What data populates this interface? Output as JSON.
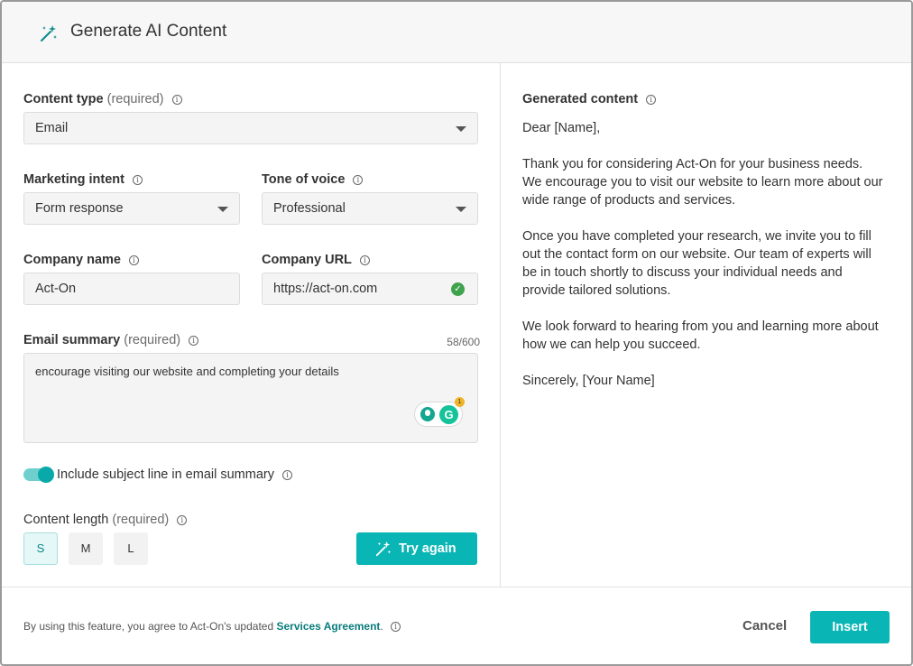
{
  "header": {
    "title": "Generate AI Content",
    "icon": "magic-wand-icon"
  },
  "form": {
    "content_type": {
      "label": "Content type",
      "required": "(required)",
      "value": "Email"
    },
    "marketing_intent": {
      "label": "Marketing intent",
      "value": "Form response"
    },
    "tone_of_voice": {
      "label": "Tone of voice",
      "value": "Professional"
    },
    "company_name": {
      "label": "Company name",
      "value": "Act-On"
    },
    "company_url": {
      "label": "Company URL",
      "value": "https://act-on.com"
    },
    "email_summary": {
      "label": "Email summary",
      "required": "(required)",
      "counter": "58/600",
      "value": "encourage visiting our website and completing your details"
    },
    "grammarly": {
      "letter": "G",
      "badge_count": "1"
    },
    "include_subject": {
      "label": "Include subject line in email summary",
      "enabled": true
    },
    "content_length": {
      "label": "Content length",
      "required": "(required)",
      "options": [
        "S",
        "M",
        "L"
      ],
      "selected": "S"
    },
    "try_again_label": "Try again"
  },
  "generated": {
    "label": "Generated content",
    "paragraphs": [
      "Dear [Name],",
      "Thank you for considering Act-On for your business needs. We encourage you to visit our website to learn more about our wide range of products and services.",
      "Once you have completed your research, we invite you to fill out the contact form on our website. Our team of experts will be in touch shortly to discuss your individual needs and provide tailored solutions.",
      "We look forward to hearing from you and learning more about how we can help you succeed.",
      "Sincerely, [Your Name]"
    ]
  },
  "footer": {
    "legal_prefix": "By using this feature, you agree to Act-On's updated",
    "legal_link": "Services Agreement",
    "legal_suffix": ".",
    "cancel_label": "Cancel",
    "insert_label": "Insert"
  },
  "colors": {
    "accent": "#0ab5b5",
    "link": "#0a7c7c"
  }
}
